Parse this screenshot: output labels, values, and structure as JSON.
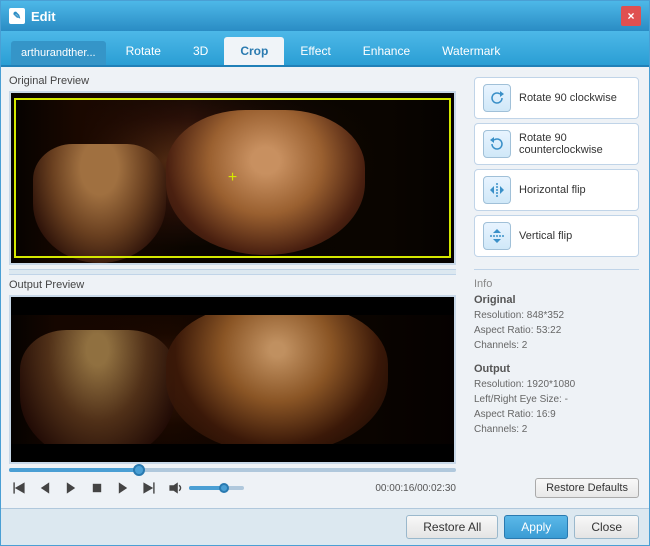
{
  "window": {
    "title": "Edit",
    "close_label": "×"
  },
  "tabs": {
    "file_tab": "arthurandther...",
    "items": [
      "Rotate",
      "3D",
      "Crop",
      "Effect",
      "Enhance",
      "Watermark"
    ],
    "active": "Crop"
  },
  "sections": {
    "original_preview_label": "Original Preview",
    "output_preview_label": "Output Preview"
  },
  "actions": [
    {
      "id": "rotate-cw",
      "label": "Rotate 90 clockwise"
    },
    {
      "id": "rotate-ccw",
      "label": "Rotate 90 counterclockwise"
    },
    {
      "id": "hflip",
      "label": "Horizontal flip"
    },
    {
      "id": "vflip",
      "label": "Vertical flip"
    }
  ],
  "info": {
    "section_label": "Info",
    "original_label": "Original",
    "original_resolution": "Resolution: 848*352",
    "original_aspect": "Aspect Ratio: 53:22",
    "original_channels": "Channels: 2",
    "output_label": "Output",
    "output_resolution": "Resolution: 1920*1080",
    "output_leftright": "Left/Right Eye Size: -",
    "output_aspect": "Aspect Ratio: 16:9",
    "output_channels": "Channels: 2"
  },
  "playback": {
    "time_display": "00:00:16/00:02:30"
  },
  "buttons": {
    "restore_defaults": "Restore Defaults",
    "restore_all": "Restore All",
    "apply": "Apply",
    "close": "Close"
  }
}
